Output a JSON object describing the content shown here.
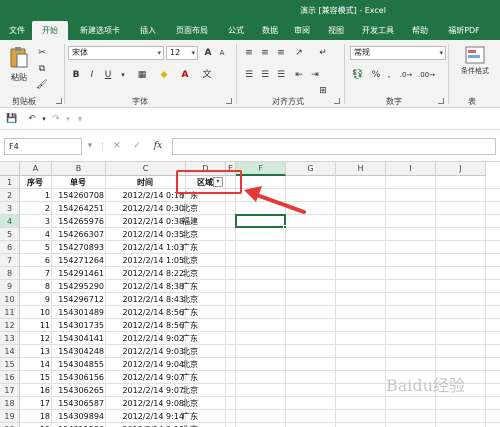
{
  "window": {
    "title": "演示 [兼容模式] - Excel"
  },
  "ribbon_tabs": [
    {
      "label": "文件"
    },
    {
      "label": "开始"
    },
    {
      "label": "新建选项卡"
    },
    {
      "label": "插入"
    },
    {
      "label": "页面布局"
    },
    {
      "label": "公式"
    },
    {
      "label": "数据"
    },
    {
      "label": "审阅"
    },
    {
      "label": "视图"
    },
    {
      "label": "开发工具"
    },
    {
      "label": "帮助"
    },
    {
      "label": "福昕PDF"
    }
  ],
  "ribbon": {
    "paste_label": "粘贴",
    "font_name": "宋体",
    "font_size": "12",
    "bold": "B",
    "italic": "I",
    "underline": "U",
    "grow_font": "A",
    "shrink_font": "A",
    "number_format": "常规",
    "percent": "%",
    "comma": ",",
    "cond_format_label": "条件格式",
    "groups": {
      "clipboard": "剪贴板",
      "font": "字体",
      "alignment": "对齐方式",
      "number": "数字",
      "styles": "表"
    }
  },
  "formula_bar": {
    "name_box": "F4",
    "cancel": "✕",
    "enter": "✓",
    "fx": "fx",
    "value": ""
  },
  "columns": [
    "A",
    "B",
    "C",
    "D",
    "E",
    "F",
    "G",
    "H",
    "I",
    "J"
  ],
  "table": {
    "headers": [
      "序号",
      "单号",
      "时间",
      "区域"
    ],
    "rows": [
      [
        "1",
        "154260708",
        "2012/2/14 0:18",
        "广东"
      ],
      [
        "2",
        "154264251",
        "2012/2/14 0:30",
        "北京"
      ],
      [
        "3",
        "154265976",
        "2012/2/14 0:38",
        "福建"
      ],
      [
        "4",
        "154266307",
        "2012/2/14 0:35",
        "北京"
      ],
      [
        "5",
        "154270893",
        "2012/2/14 1:03",
        "广东"
      ],
      [
        "6",
        "154271264",
        "2012/2/14 1:05",
        "北京"
      ],
      [
        "7",
        "154291461",
        "2012/2/14 8:22",
        "北京"
      ],
      [
        "8",
        "154295290",
        "2012/2/14 8:38",
        "广东"
      ],
      [
        "9",
        "154296712",
        "2012/2/14 8:43",
        "北京"
      ],
      [
        "10",
        "154301489",
        "2012/2/14 8:56",
        "广东"
      ],
      [
        "11",
        "154301735",
        "2012/2/14 8:56",
        "广东"
      ],
      [
        "12",
        "154304141",
        "2012/2/14 9:02",
        "广东"
      ],
      [
        "13",
        "154304248",
        "2012/2/14 9:03",
        "北京"
      ],
      [
        "14",
        "154304855",
        "2012/2/14 9:04",
        "北京"
      ],
      [
        "15",
        "154306156",
        "2012/2/14 9:07",
        "广东"
      ],
      [
        "16",
        "154306265",
        "2012/2/14 9:07",
        "北京"
      ],
      [
        "17",
        "154306587",
        "2012/2/14 9:08",
        "北京"
      ],
      [
        "18",
        "154309894",
        "2012/2/14 9:14",
        "广东"
      ],
      [
        "19",
        "154311586",
        "2012/2/14 9:18",
        "北京"
      ]
    ]
  },
  "filter_icon": "▾",
  "watermark": "Baidu经验",
  "colors": {
    "excel_green": "#217346",
    "highlight_red": "#e53935"
  }
}
